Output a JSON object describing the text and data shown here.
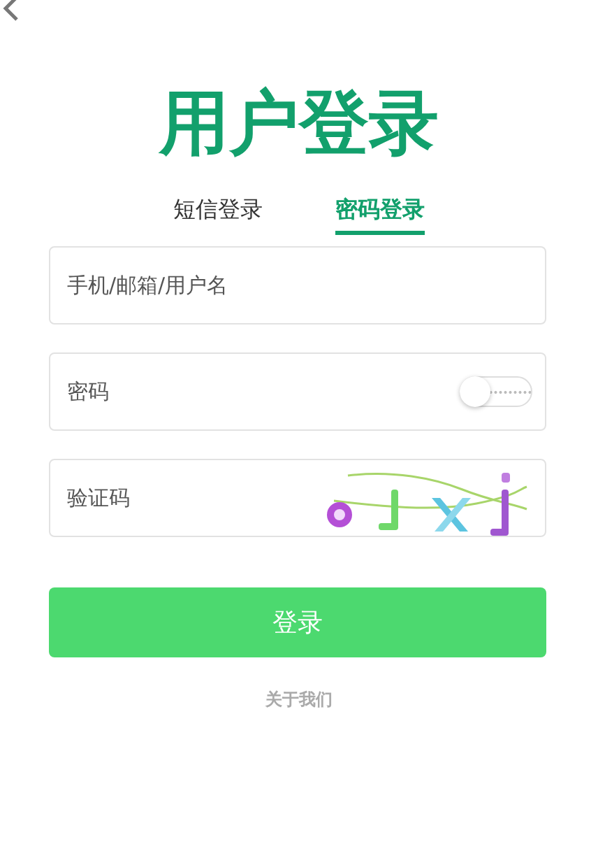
{
  "title": "用户登录",
  "tabs": [
    {
      "label": "短信登录",
      "selected": false
    },
    {
      "label": "密码登录",
      "selected": true
    }
  ],
  "fields": [
    {
      "kind": "text",
      "placeholder": "手机/邮箱/用户名"
    },
    {
      "kind": "password",
      "placeholder": "密码",
      "show_password": {
        "on": false
      }
    },
    {
      "kind": "captcha",
      "placeholder": "验证码"
    }
  ],
  "submit": "登录",
  "footer_link": "关于我们"
}
